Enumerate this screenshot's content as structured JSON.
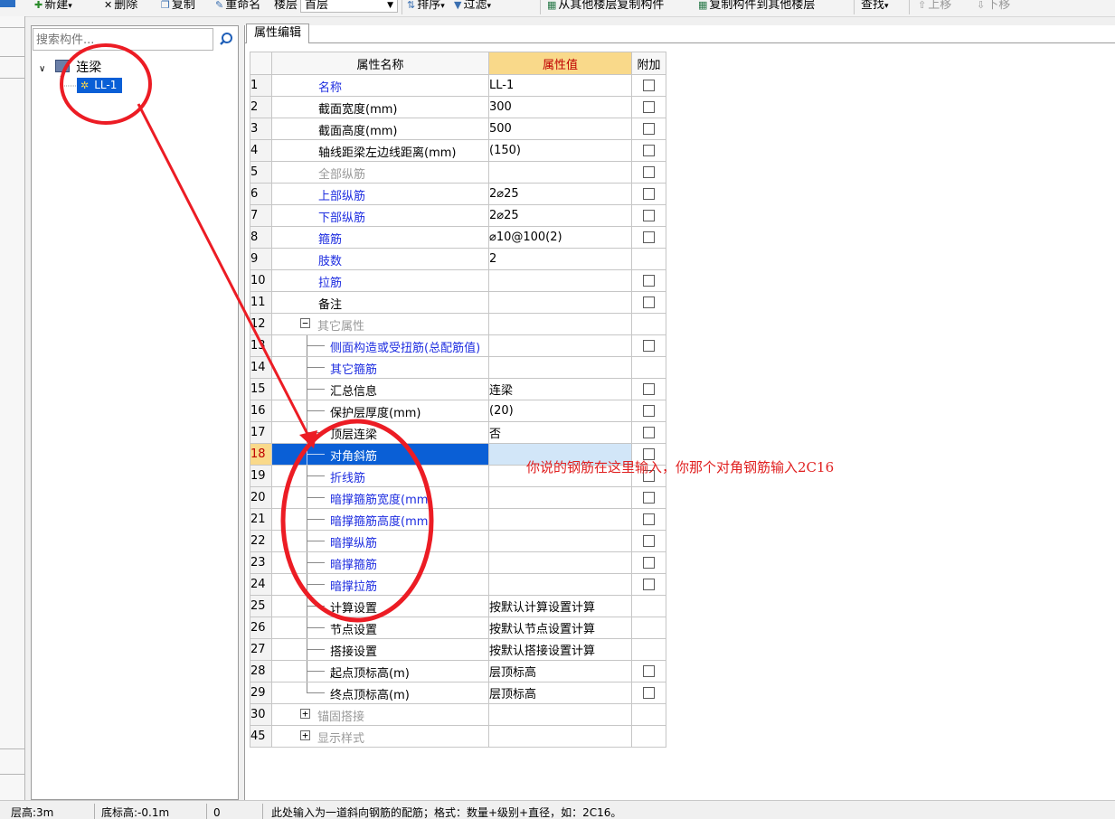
{
  "toolbar": {
    "new": "新建",
    "delete": "删除",
    "copy": "复制",
    "rename": "重命名",
    "floor_label": "楼层",
    "floor_value": "首层",
    "sort": "排序",
    "filter": "过滤",
    "copy_from": "从其他楼层复制构件",
    "copy_to": "复制构件到其他楼层",
    "find": "查找",
    "move_up": "上移",
    "move_down": "下移"
  },
  "tree": {
    "search_placeholder": "搜索构件...",
    "root_label": "连梁",
    "child_label": "LL-1"
  },
  "prop": {
    "tab_label": "属性编辑",
    "col_name": "属性名称",
    "col_value": "属性值",
    "col_add": "附加",
    "rows": [
      {
        "num": "1",
        "name": "名称",
        "value": "LL-1"
      },
      {
        "num": "2",
        "name": "截面宽度(mm)",
        "value": "300"
      },
      {
        "num": "3",
        "name": "截面高度(mm)",
        "value": "500"
      },
      {
        "num": "4",
        "name": "轴线距梁左边线距离(mm)",
        "value": "(150)"
      },
      {
        "num": "5",
        "name": "全部纵筋",
        "value": ""
      },
      {
        "num": "6",
        "name": "上部纵筋",
        "value": "2⌀25"
      },
      {
        "num": "7",
        "name": "下部纵筋",
        "value": "2⌀25"
      },
      {
        "num": "8",
        "name": "箍筋",
        "value": "⌀10@100(2)"
      },
      {
        "num": "9",
        "name": "肢数",
        "value": "2"
      },
      {
        "num": "10",
        "name": "拉筋",
        "value": ""
      },
      {
        "num": "11",
        "name": "备注",
        "value": ""
      },
      {
        "num": "12",
        "name": "其它属性",
        "value": ""
      },
      {
        "num": "13",
        "name": "侧面构造或受扭筋(总配筋值)",
        "value": ""
      },
      {
        "num": "14",
        "name": "其它箍筋",
        "value": ""
      },
      {
        "num": "15",
        "name": "汇总信息",
        "value": "连梁"
      },
      {
        "num": "16",
        "name": "保护层厚度(mm)",
        "value": "(20)"
      },
      {
        "num": "17",
        "name": "顶层连梁",
        "value": "否"
      },
      {
        "num": "18",
        "name": "对角斜筋",
        "value": ""
      },
      {
        "num": "19",
        "name": "折线筋",
        "value": ""
      },
      {
        "num": "20",
        "name": "暗撑箍筋宽度(mm)",
        "value": ""
      },
      {
        "num": "21",
        "name": "暗撑箍筋高度(mm)",
        "value": ""
      },
      {
        "num": "22",
        "name": "暗撑纵筋",
        "value": ""
      },
      {
        "num": "23",
        "name": "暗撑箍筋",
        "value": ""
      },
      {
        "num": "24",
        "name": "暗撑拉筋",
        "value": ""
      },
      {
        "num": "25",
        "name": "计算设置",
        "value": "按默认计算设置计算"
      },
      {
        "num": "26",
        "name": "节点设置",
        "value": "按默认节点设置计算"
      },
      {
        "num": "27",
        "name": "搭接设置",
        "value": "按默认搭接设置计算"
      },
      {
        "num": "28",
        "name": "起点顶标高(m)",
        "value": "层顶标高"
      },
      {
        "num": "29",
        "name": "终点顶标高(m)",
        "value": "层顶标高"
      },
      {
        "num": "30",
        "name": "锚固搭接",
        "value": ""
      },
      {
        "num": "45",
        "name": "显示样式",
        "value": ""
      }
    ]
  },
  "annotation": {
    "text": "你说的钢筋在这里输入，你那个对角钢筋输入2C16"
  },
  "status": {
    "floor_height": "层高:3m",
    "bottom_elev": "底标高:-0.1m",
    "zero": "0",
    "hint": "此处输入为一道斜向钢筋的配筋；格式：数量+级别+直径，如：2C16。"
  },
  "colors": {
    "selection": "#0a5fd6",
    "header_value_bg": "#f9d98a",
    "blue_text": "#1f2ee0",
    "annotation_red": "#e02020"
  }
}
